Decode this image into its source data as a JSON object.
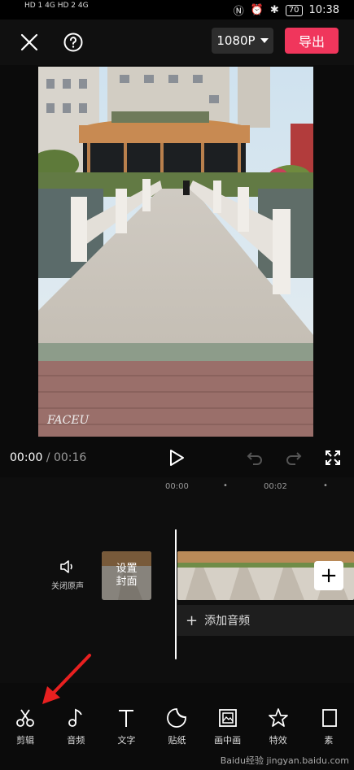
{
  "status_bar": {
    "network_left": "HD 1  4G  HD 2  4G",
    "battery": "70",
    "time": "10:38"
  },
  "toolbar": {
    "resolution": "1080P",
    "export_label": "导出"
  },
  "preview": {
    "watermark": "FACEU"
  },
  "playback": {
    "current_time": "00:00",
    "separator": "/",
    "total_time": "00:16"
  },
  "timeline": {
    "ruler_ticks": [
      "00:00",
      "00:02"
    ],
    "mute_label": "关闭原声",
    "cover_label": "设置\n封面",
    "add_audio_label": "添加音频"
  },
  "bottom_tabs": [
    {
      "label": "剪辑",
      "icon": "scissors-icon"
    },
    {
      "label": "音频",
      "icon": "music-note-icon"
    },
    {
      "label": "文字",
      "icon": "text-icon"
    },
    {
      "label": "贴纸",
      "icon": "sticker-icon"
    },
    {
      "label": "画中画",
      "icon": "picture-in-picture-icon"
    },
    {
      "label": "特效",
      "icon": "effects-star-icon"
    },
    {
      "label": "素",
      "icon": "material-icon"
    }
  ],
  "watermark_credit": "Baidu经验 jingyan.baidu.com",
  "colors": {
    "accent": "#f0365c",
    "annotation_arrow": "#e82020"
  }
}
